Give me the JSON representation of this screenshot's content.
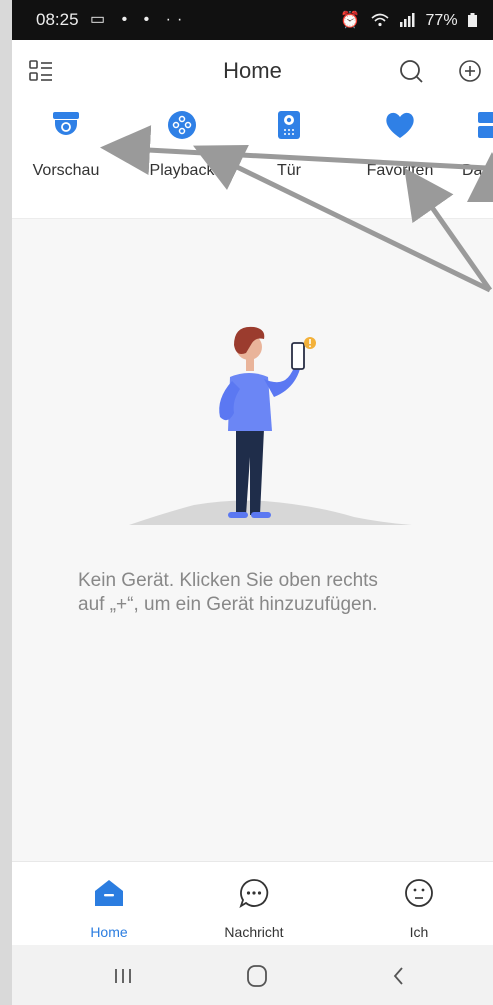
{
  "status_bar": {
    "time": "08:25",
    "left_icons": "▭ • • ··",
    "alarm_icon": "alarm-icon",
    "wifi_icon": "wifi-icon",
    "signal_icon": "signal-icon",
    "battery": "77%"
  },
  "header": {
    "title": "Home",
    "menu_icon": "list-menu-icon",
    "search_icon": "search-icon",
    "add_icon": "add-circle-icon"
  },
  "quick_actions": [
    {
      "label": "Vorschau",
      "icon": "camera-icon"
    },
    {
      "label": "Playback",
      "icon": "playback-icon"
    },
    {
      "label": "Tür",
      "icon": "doorbell-icon"
    },
    {
      "label": "Favoriten",
      "icon": "heart-icon"
    },
    {
      "label": "Da",
      "icon": "device-icon"
    }
  ],
  "empty_state": {
    "message": "Kein Gerät. Klicken Sie oben rechts auf „+“, um ein Gerät hinzuzufügen."
  },
  "bottom_tabs": [
    {
      "label": "Home",
      "icon": "home-icon",
      "active": true
    },
    {
      "label": "Nachricht",
      "icon": "message-icon",
      "active": false
    },
    {
      "label": "Ich",
      "icon": "profile-icon",
      "active": false
    }
  ],
  "system_nav": [
    "recent-apps-icon",
    "home-circle-icon",
    "back-icon"
  ],
  "colors": {
    "accent": "#2b7de0",
    "icon_blue": "#2f80e6",
    "annotation_arrow": "#9a9a9a"
  }
}
